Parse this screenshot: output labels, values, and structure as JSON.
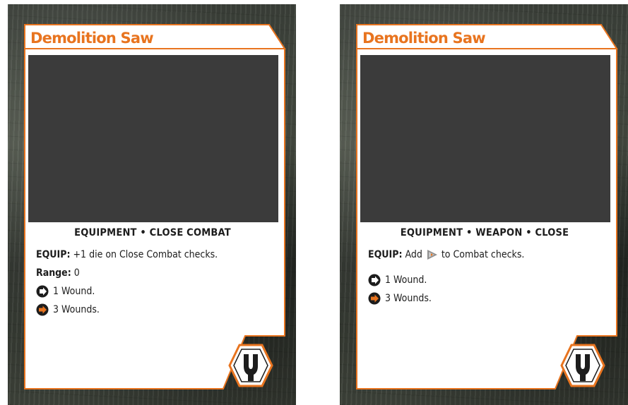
{
  "colors": {
    "accent": "#e8741f",
    "art_placeholder": "#3b3b3b",
    "text": "#1d1d1d"
  },
  "cards": [
    {
      "title": "Demolition Saw",
      "keywords": "EQUIPMENT • CLOSE COMBAT",
      "equip_label": "EQUIP:",
      "equip_text": "+1 die on Close Combat checks.",
      "range_label": "Range:",
      "range_value": "0",
      "effect_1": "1 Wound.",
      "effect_2": "3 Wounds.",
      "icons": [
        "black-arrow-icon",
        "orange-arrow-icon",
        "wrench-icon"
      ]
    },
    {
      "title": "Demolition Saw",
      "keywords": "EQUIPMENT • WEAPON • CLOSE",
      "equip_label": "EQUIP:",
      "equip_text_before": "Add",
      "equip_text_after": "to Combat checks.",
      "effect_1": "1 Wound.",
      "effect_2": "3 Wounds.",
      "icons": [
        "proficiency-die-icon",
        "black-arrow-icon",
        "orange-arrow-icon",
        "wrench-icon"
      ]
    }
  ]
}
